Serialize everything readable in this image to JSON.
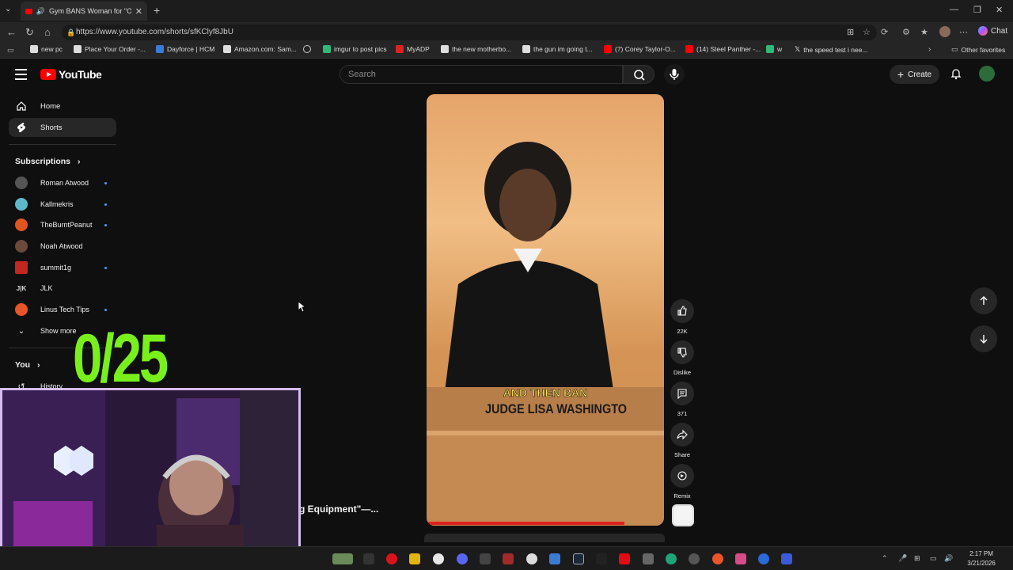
{
  "browser": {
    "tab_title": "Gym BANS Woman for \"Over",
    "url": "https://www.youtube.com/shorts/sfKClyf8JbU",
    "chat_label": "Chat",
    "bookmarks": [
      "new pc",
      "Place Your Order -...",
      "Dayforce | HCM",
      "Amazon.com: Sam...",
      "",
      "imgur to post pics",
      "MyADP",
      "the new motherbo...",
      "the gun im going t...",
      "(7) Corey Taylor-O...",
      "(14) Steel Panther -...",
      "w",
      "the speed test i nee..."
    ],
    "other_favorites": "Other favorites"
  },
  "youtube": {
    "logo_text": "YouTube",
    "search_placeholder": "Search",
    "create_label": "Create",
    "nav": {
      "home": "Home",
      "shorts": "Shorts"
    },
    "subscriptions_heading": "Subscriptions",
    "subscriptions": [
      {
        "name": "Roman Atwood",
        "color": "#555555"
      },
      {
        "name": "Kallmekris",
        "color": "#5fb8c9"
      },
      {
        "name": "TheBurntPeanut",
        "color": "#e0541f"
      },
      {
        "name": "Noah Atwood",
        "color": "#6b4a3a"
      },
      {
        "name": "summit1g",
        "color": "#c2281f"
      },
      {
        "name": "JLK",
        "color": "#dddddd"
      },
      {
        "name": "Linus Tech Tips",
        "color": "#e8552b"
      }
    ],
    "show_more": "Show more",
    "you_heading": "You",
    "history": "History",
    "video_title": "g Equipment\"—...",
    "actions": {
      "likes": "22K",
      "dislike": "Dislike",
      "comments": "371",
      "share": "Share",
      "remix": "Remix"
    },
    "caption": {
      "top": "AND THEN BAN",
      "bottom": "JUDGE LISA WASHINGTO"
    }
  },
  "overlay": {
    "counter": "0/25",
    "counter_color": "#78f01c"
  },
  "taskbar": {
    "time": "2:17 PM",
    "date": "3/21/2026"
  }
}
